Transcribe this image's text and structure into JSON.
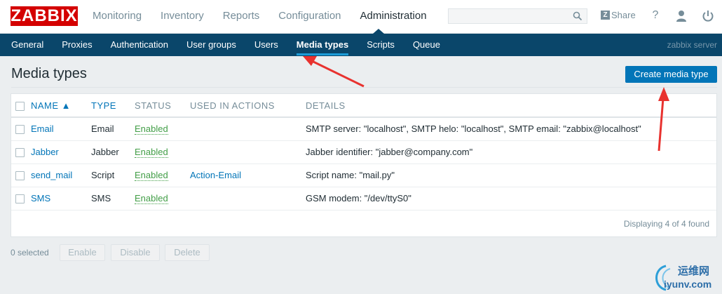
{
  "header": {
    "logo": "ZABBIX",
    "nav": [
      "Monitoring",
      "Inventory",
      "Reports",
      "Configuration",
      "Administration"
    ],
    "share_label": "Share",
    "search": {
      "value": "",
      "placeholder": ""
    },
    "help_glyph": "?"
  },
  "subnav": {
    "items": [
      "General",
      "Proxies",
      "Authentication",
      "User groups",
      "Users",
      "Media types",
      "Scripts",
      "Queue"
    ],
    "server": "zabbix server"
  },
  "page": {
    "title": "Media types",
    "create_button": "Create media type"
  },
  "table": {
    "headers": {
      "name": "NAME ▲",
      "type": "TYPE",
      "status": "STATUS",
      "used": "USED IN ACTIONS",
      "details": "DETAILS"
    },
    "rows": [
      {
        "name": "Email",
        "type": "Email",
        "status": "Enabled",
        "used": "",
        "details": "SMTP server: \"localhost\", SMTP helo: \"localhost\", SMTP email: \"zabbix@localhost\""
      },
      {
        "name": "Jabber",
        "type": "Jabber",
        "status": "Enabled",
        "used": "",
        "details": "Jabber identifier: \"jabber@company.com\""
      },
      {
        "name": "send_mail",
        "type": "Script",
        "status": "Enabled",
        "used": "Action-Email",
        "details": "Script name: \"mail.py\""
      },
      {
        "name": "SMS",
        "type": "SMS",
        "status": "Enabled",
        "used": "",
        "details": "GSM modem: \"/dev/ttyS0\""
      }
    ],
    "footer": "Displaying 4 of 4 found"
  },
  "actions": {
    "selected": "0 selected",
    "enable": "Enable",
    "disable": "Disable",
    "delete": "Delete"
  },
  "watermark": {
    "line1": "运维网",
    "line2": "iyunv.com"
  },
  "colors": {
    "logo": "#d40000",
    "subnav": "#0a466a",
    "primary": "#0275b8",
    "enabled": "#429e47",
    "annotation": "#e8322f"
  }
}
